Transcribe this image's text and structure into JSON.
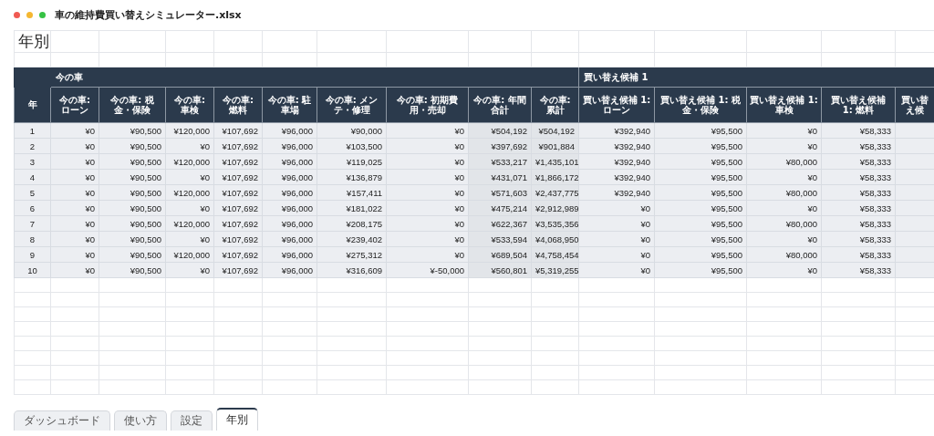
{
  "window": {
    "title": "車の維持費買い替えシミュレーター.xlsx"
  },
  "sheet": {
    "title": "年別",
    "row_header": "年",
    "groups": [
      {
        "label": "今の車",
        "columns": [
          {
            "label": "今の車: ローン",
            "kind": "item"
          },
          {
            "label": "今の車: 税金・保険",
            "kind": "item"
          },
          {
            "label": "今の車: 車検",
            "kind": "item"
          },
          {
            "label": "今の車: 燃料",
            "kind": "item"
          },
          {
            "label": "今の車: 駐車場",
            "kind": "item"
          },
          {
            "label": "今の車: メンテ・修理",
            "kind": "item"
          },
          {
            "label": "今の車: 初期費用・売却",
            "kind": "item"
          },
          {
            "label": "今の車: 年間合計",
            "kind": "total"
          },
          {
            "label": "今の車: 累計",
            "kind": "total"
          }
        ]
      },
      {
        "label": "買い替え候補 1",
        "columns": [
          {
            "label": "買い替え候補 1: ローン",
            "kind": "item"
          },
          {
            "label": "買い替え候補 1: 税金・保険",
            "kind": "item"
          },
          {
            "label": "買い替え候補 1: 車検",
            "kind": "item"
          },
          {
            "label": "買い替え候補 1: 燃料",
            "kind": "item"
          },
          {
            "label": "買い替え候",
            "kind": "item"
          }
        ]
      }
    ],
    "rows": [
      {
        "year": "1",
        "values": [
          "¥0",
          "¥90,500",
          "¥120,000",
          "¥107,692",
          "¥96,000",
          "¥90,000",
          "¥0",
          "¥504,192",
          "¥504,192",
          "¥392,940",
          "¥95,500",
          "¥0",
          "¥58,333"
        ]
      },
      {
        "year": "2",
        "values": [
          "¥0",
          "¥90,500",
          "¥0",
          "¥107,692",
          "¥96,000",
          "¥103,500",
          "¥0",
          "¥397,692",
          "¥901,884",
          "¥392,940",
          "¥95,500",
          "¥0",
          "¥58,333"
        ]
      },
      {
        "year": "3",
        "values": [
          "¥0",
          "¥90,500",
          "¥120,000",
          "¥107,692",
          "¥96,000",
          "¥119,025",
          "¥0",
          "¥533,217",
          "¥1,435,101",
          "¥392,940",
          "¥95,500",
          "¥80,000",
          "¥58,333"
        ]
      },
      {
        "year": "4",
        "values": [
          "¥0",
          "¥90,500",
          "¥0",
          "¥107,692",
          "¥96,000",
          "¥136,879",
          "¥0",
          "¥431,071",
          "¥1,866,172",
          "¥392,940",
          "¥95,500",
          "¥0",
          "¥58,333"
        ]
      },
      {
        "year": "5",
        "values": [
          "¥0",
          "¥90,500",
          "¥120,000",
          "¥107,692",
          "¥96,000",
          "¥157,411",
          "¥0",
          "¥571,603",
          "¥2,437,775",
          "¥392,940",
          "¥95,500",
          "¥80,000",
          "¥58,333"
        ]
      },
      {
        "year": "6",
        "values": [
          "¥0",
          "¥90,500",
          "¥0",
          "¥107,692",
          "¥96,000",
          "¥181,022",
          "¥0",
          "¥475,214",
          "¥2,912,989",
          "¥0",
          "¥95,500",
          "¥0",
          "¥58,333"
        ]
      },
      {
        "year": "7",
        "values": [
          "¥0",
          "¥90,500",
          "¥120,000",
          "¥107,692",
          "¥96,000",
          "¥208,175",
          "¥0",
          "¥622,367",
          "¥3,535,356",
          "¥0",
          "¥95,500",
          "¥80,000",
          "¥58,333"
        ]
      },
      {
        "year": "8",
        "values": [
          "¥0",
          "¥90,500",
          "¥0",
          "¥107,692",
          "¥96,000",
          "¥239,402",
          "¥0",
          "¥533,594",
          "¥4,068,950",
          "¥0",
          "¥95,500",
          "¥0",
          "¥58,333"
        ]
      },
      {
        "year": "9",
        "values": [
          "¥0",
          "¥90,500",
          "¥120,000",
          "¥107,692",
          "¥96,000",
          "¥275,312",
          "¥0",
          "¥689,504",
          "¥4,758,454",
          "¥0",
          "¥95,500",
          "¥80,000",
          "¥58,333"
        ]
      },
      {
        "year": "10",
        "values": [
          "¥0",
          "¥90,500",
          "¥0",
          "¥107,692",
          "¥96,000",
          "¥316,609",
          "¥-50,000",
          "¥560,801",
          "¥5,319,255",
          "¥0",
          "¥95,500",
          "¥0",
          "¥58,333"
        ]
      }
    ]
  },
  "tabs": [
    {
      "label": "ダッシュボード",
      "selected": false
    },
    {
      "label": "使い方",
      "selected": false
    },
    {
      "label": "設定",
      "selected": false
    },
    {
      "label": "年別",
      "selected": true
    }
  ]
}
